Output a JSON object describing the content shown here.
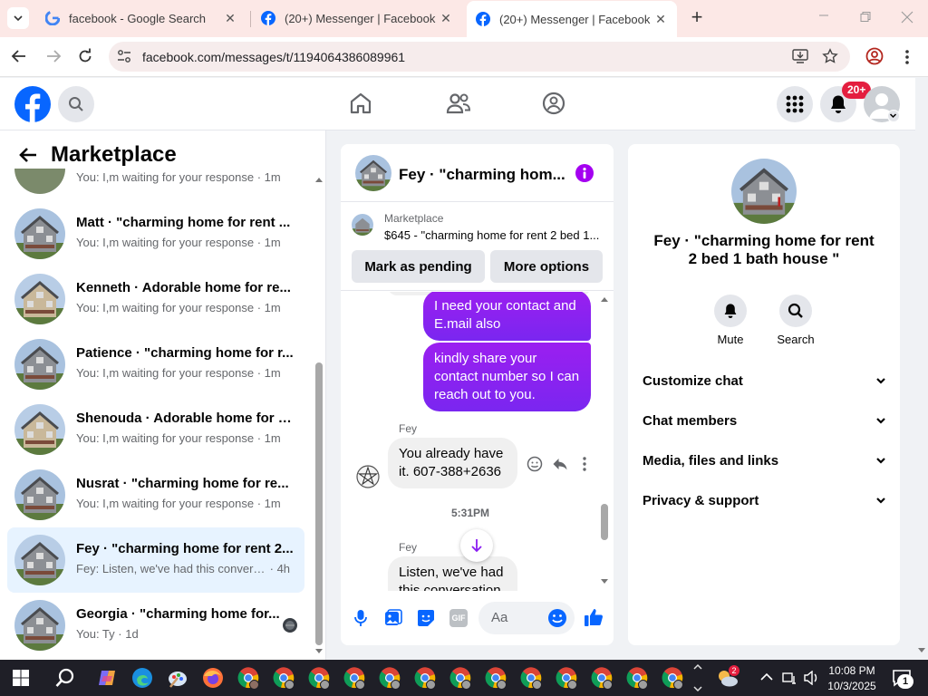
{
  "browser": {
    "tabs": [
      {
        "title": "facebook - Google Search",
        "active": false
      },
      {
        "title": "(20+) Messenger | Facebook",
        "active": false
      },
      {
        "title": "(20+) Messenger | Facebook",
        "active": true
      }
    ],
    "url": "facebook.com/messages/t/1194064386089961"
  },
  "header": {
    "notifications_badge": "20+"
  },
  "sidebar": {
    "title": "Marketplace",
    "top_partial_preview": "You: I,m waiting for your response",
    "top_partial_time": "1m",
    "conversations": [
      {
        "name": "Matt · \"charming home for rent ...",
        "preview": "You: I,m waiting for your response",
        "time": "1m",
        "selected": false
      },
      {
        "name": "Kenneth · Adorable home for re...",
        "preview": "You: I,m waiting for your response",
        "time": "1m",
        "selected": false
      },
      {
        "name": "Patience · \"charming home for r...",
        "preview": "You: I,m waiting for your response",
        "time": "1m",
        "selected": false
      },
      {
        "name": "Shenouda · Adorable home for r...",
        "preview": "You: I,m waiting for your response",
        "time": "1m",
        "selected": false
      },
      {
        "name": "Nusrat · \"charming home for re...",
        "preview": "You: I,m waiting for your response",
        "time": "1m",
        "selected": false
      },
      {
        "name": "Fey · \"charming home for rent 2...",
        "preview": "Fey: Listen, we've had this conversa...",
        "time": "4h",
        "selected": true
      },
      {
        "name": "Georgia · \"charming home for...",
        "preview": "You: Ty",
        "time": "1d",
        "selected": false
      }
    ]
  },
  "chat": {
    "title": "Fey · \"charming hom...",
    "listing_label": "Marketplace",
    "listing_text": "$645 - \"charming home for rent 2 bed 1...",
    "mark_pending": "Mark as pending",
    "more_options": "More options",
    "messages": {
      "m1": "I need your contact and E.mail also",
      "m2": "kindly share your contact number so I can reach out to you.",
      "sender1": "Fey",
      "m3": "You already have it. 607-388+2636",
      "timestamp": "5:31PM",
      "sender2": "Fey",
      "m4": "Listen, we've had this conversation"
    },
    "composer_placeholder": "Aa"
  },
  "info": {
    "name": "Fey · \"charming home for rent 2 bed 1 bath house \"",
    "mute": "Mute",
    "search": "Search",
    "sections": [
      "Customize chat",
      "Chat members",
      "Media, files and links",
      "Privacy & support"
    ]
  },
  "taskbar": {
    "time": "10:08 PM",
    "date": "10/3/2025",
    "weather_badge": "2",
    "notif_count": "1"
  },
  "colors": {
    "facebook_blue": "#0866ff",
    "messenger_purple": "#8a1cf2",
    "badge_red": "#e41e3f"
  }
}
